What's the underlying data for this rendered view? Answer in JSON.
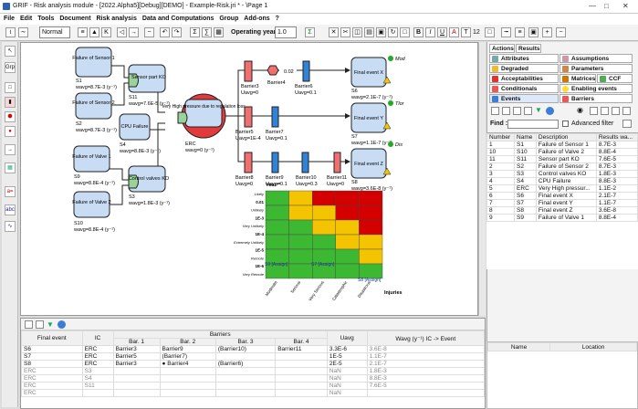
{
  "window": {
    "title": "GRIF - Risk analysis module - [2022.Alpha5][Debug][DEMO] - Example-Risk.jri * - \\Page 1"
  },
  "menu": [
    "File",
    "Edit",
    "Tools",
    "Document",
    "Risk analysis",
    "Data and Computations",
    "Group",
    "Add-ons",
    "?"
  ],
  "toolbar": {
    "style_value": "Normal",
    "operating_years_label": "Operating years",
    "operating_years_value": "1.0",
    "font_size": "12"
  },
  "diagram": {
    "inputs": [
      {
        "name": "Failure of Sensor 1",
        "id": "S1",
        "wavg": "wavg=8.7E-3 (y⁻¹)"
      },
      {
        "name": "Failure of Sensor 2",
        "id": "S2",
        "wavg": "wavg=8.7E-3 (y⁻¹)"
      },
      {
        "name": "Failure of Valve 1",
        "id": "S9",
        "wavg": "wavg=8.8E-4 (y⁻¹)"
      },
      {
        "name": "Failure of Valve 2",
        "id": "S10",
        "wavg": "wavg=8.8E-4 (y⁻¹)"
      }
    ],
    "gates": [
      {
        "name": "Sensor part KO",
        "id": "S11",
        "wavg": "wavg=7.6E-5 (y⁻¹)"
      },
      {
        "name": "CPU Failure",
        "id": "S4",
        "wavg": "wavg=8.8E-3 (y⁻¹)"
      },
      {
        "name": "Control valves KO",
        "id": "S3",
        "wavg": "wavg=1.8E-3 (y⁻¹)"
      }
    ],
    "erc": {
      "name": "Very High pressure due to regulation loss",
      "id": "ERC",
      "wavg": "wavg=0 (y⁻¹)"
    },
    "barriers": [
      {
        "label": "Barrier3",
        "uavg": "Uavg=0"
      },
      {
        "label": "Barrier4",
        "uavg": ""
      },
      {
        "label": "Barrier6",
        "uavg": "Uavg=0.1"
      },
      {
        "label": "Barrier5",
        "uavg": "Uavg=1E-4"
      },
      {
        "label": "Barrier7",
        "uavg": "Uavg=0.1"
      },
      {
        "label": "Barrier8",
        "uavg": "Uavg=0"
      },
      {
        "label": "Barrier9",
        "uavg": "Uavg=0.1"
      },
      {
        "label": "Barrier10",
        "uavg": "Uavg=0.3"
      },
      {
        "label": "Barrier11",
        "uavg": "Uavg=0"
      }
    ],
    "factor": "0.02",
    "finals": [
      {
        "name": "Final event X",
        "id": "S6",
        "wavg": "wavg=2.1E-7 (y⁻¹)",
        "tag": "Mod"
      },
      {
        "name": "Final event Y",
        "id": "S7",
        "wavg": "wavg=1.1E-7 (y⁻¹)",
        "tag": "Tlor"
      },
      {
        "name": "Final event Z",
        "id": "S8",
        "wavg": "wavg=3.6E-8 (y⁻¹)",
        "tag": "Dis"
      }
    ],
    "matrix": {
      "y_axis_title": "Year⁻¹",
      "x_axis_title": "Injuries",
      "row_labels": [
        "Likely",
        "0.01",
        "Unlikely",
        "1E-3",
        "Very Unlikely",
        "1E-4",
        "Extremely Unlikely",
        "1E-5",
        "Remote",
        "1E-6",
        "Very Remote"
      ],
      "col_labels": [
        "Moderate",
        "Serious",
        "Very Serious",
        "Catastrophic",
        "Disastrous"
      ],
      "assign_labels": [
        "S9 [Assign]",
        "S7 [Assign]",
        "S8 [Assign]"
      ],
      "colors": {
        "green": "#3cb832",
        "yellow": "#f5c400",
        "red": "#d40000"
      }
    }
  },
  "bottom_table": {
    "headers": [
      "Final event",
      "IC",
      "Barriers",
      "Uavg",
      "Wavg (y⁻¹) IC -> Event"
    ],
    "bar_headers": [
      "Bar. 1",
      "Bar. 2",
      "Bar. 3",
      "Bar. 4"
    ],
    "rows": [
      [
        "S6",
        "ERC",
        "Barrier3",
        "Barrier9",
        "(Barrier10)",
        "Barrier11",
        "3.3E-6",
        "3.6E-8"
      ],
      [
        "S7",
        "ERC",
        "Barrier5",
        "(Barrier7)",
        "",
        "",
        "1E-5",
        "1.1E-7"
      ],
      [
        "S8",
        "ERC",
        "Barrier3",
        "● Barrier4",
        "(Barrier6)",
        "",
        "2E-5",
        "2.1E-7"
      ],
      [
        "ERC",
        "S3",
        "",
        "",
        "",
        "",
        "NaN",
        "1.8E-3"
      ],
      [
        "ERC",
        "S4",
        "",
        "",
        "",
        "",
        "NaN",
        "8.8E-3"
      ],
      [
        "ERC",
        "S11",
        "",
        "",
        "",
        "",
        "NaN",
        "7.6E-5"
      ],
      [
        "ERC",
        "",
        "",
        "",
        "",
        "",
        "NaN",
        ""
      ]
    ]
  },
  "right_panel": {
    "tabs_top": [
      "Actions",
      "Results"
    ],
    "tabs": [
      "Attributes",
      "Assumptions",
      "Degraded operations",
      "Parameters",
      "Acceptabilities",
      "Matrices",
      "CCF",
      "Conditionals modifiers",
      "Enabling events",
      "Events",
      "Barriers"
    ],
    "find_label": "Find :",
    "advanced_filter": "Advanced filter",
    "event_headers": [
      "Number",
      "Name",
      "Description",
      "Results wa..."
    ],
    "events": [
      [
        "1",
        "S1",
        "Failure of Sensor 1",
        "8.7E-3"
      ],
      [
        "10",
        "S10",
        "Failure of Valve 2",
        "8.8E-4"
      ],
      [
        "11",
        "S11",
        "Sensor part KO",
        "7.6E-5"
      ],
      [
        "2",
        "S2",
        "Failure of Sensor 2",
        "8.7E-3"
      ],
      [
        "3",
        "S3",
        "Control valves KO",
        "1.8E-3"
      ],
      [
        "4",
        "S4",
        "CPU Failure",
        "8.8E-3"
      ],
      [
        "5",
        "ERC",
        "Very High pressur...",
        "1.1E-2"
      ],
      [
        "6",
        "S6",
        "Final event X",
        "2.1E-7"
      ],
      [
        "7",
        "S7",
        "Final event Y",
        "1.1E-7"
      ],
      [
        "8",
        "S8",
        "Final event Z",
        "3.6E-8"
      ],
      [
        "9",
        "S9",
        "Failure of Valve 1",
        "8.8E-4"
      ]
    ],
    "name_location_headers": [
      "Name",
      "Location"
    ]
  }
}
